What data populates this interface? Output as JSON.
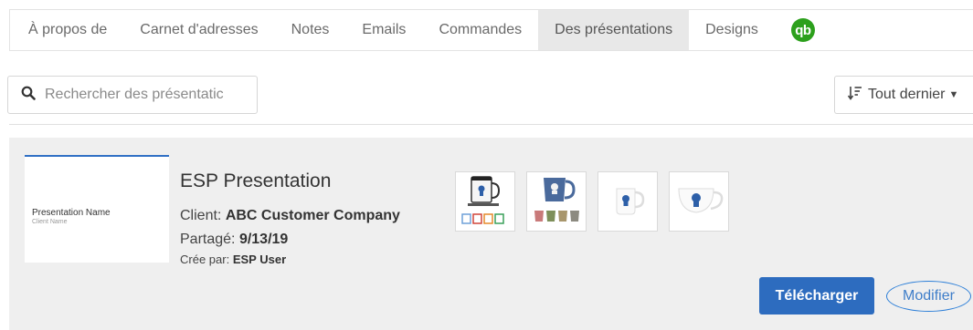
{
  "tabs": [
    {
      "label": "À propos de"
    },
    {
      "label": "Carnet d'adresses"
    },
    {
      "label": "Notes"
    },
    {
      "label": "Emails"
    },
    {
      "label": "Commandes"
    },
    {
      "label": "Des présentations",
      "active": true
    },
    {
      "label": "Designs"
    }
  ],
  "qb_logo": {
    "text": "qb",
    "color": "#2ca01c"
  },
  "search": {
    "placeholder": "Rechercher des présentatic",
    "icon": "search-icon"
  },
  "sort": {
    "label": "Tout dernier",
    "icon": "sort-icon"
  },
  "presentation": {
    "thumbnail": {
      "name": "Presentation Name",
      "client": "Client Name"
    },
    "title": "ESP Presentation",
    "client_label": "Client:",
    "client_value": "ABC Customer Company",
    "shared_label": "Partagé:",
    "shared_value": "9/13/19",
    "creator_label": "Crée par:",
    "creator_value": "ESP User",
    "products": [
      "mug-with-color-variants",
      "blue-mug-with-color-variants",
      "white-mug",
      "white-teacup"
    ],
    "download_label": "Télécharger",
    "edit_label": "Modifier"
  },
  "colors": {
    "accent": "#2d6cbf",
    "card_bg": "#efefef",
    "active_tab": "#e8e8e8"
  }
}
